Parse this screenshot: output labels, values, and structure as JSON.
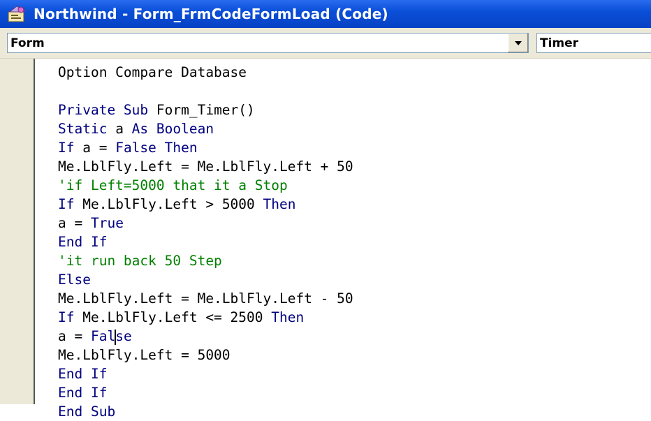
{
  "window": {
    "title": "Northwind - Form_FrmCodeFormLoad (Code)",
    "icon": "vba-code-window-icon"
  },
  "toolbar": {
    "object_combo": {
      "value": "Form"
    },
    "procedure_combo": {
      "value": "Timer"
    }
  },
  "colors": {
    "titlebar": "#0a4fd8",
    "keyword": "#00007f",
    "comment": "#007f00",
    "plain": "#000000",
    "gutter": "#ece9d8"
  },
  "code": {
    "line0": {
      "t0": "Option Compare Database"
    },
    "line2": {
      "k0": "Private Sub ",
      "t1": "Form_Timer()"
    },
    "line3": {
      "k0": "Static ",
      "t1": "a ",
      "k2": "As Boolean"
    },
    "line4": {
      "k0": "If ",
      "t1": "a = ",
      "k2": "False Then"
    },
    "line5": {
      "t0": "Me.LblFly.Left = Me.LblFly.Left + 50"
    },
    "line6": {
      "c0": "'if Left=5000 that it a Stop"
    },
    "line7": {
      "k0": "If ",
      "t1": "Me.LblFly.Left > 5000 ",
      "k2": "Then"
    },
    "line8": {
      "t0": "a = ",
      "k1": "True"
    },
    "line9": {
      "k0": "End If"
    },
    "line10": {
      "c0": "'it run back 50 Step"
    },
    "line11": {
      "k0": "Else"
    },
    "line12": {
      "t0": "Me.LblFly.Left = Me.LblFly.Left - 50"
    },
    "line13": {
      "k0": "If ",
      "t1": "Me.LblFly.Left <= 2500 ",
      "k2": "Then"
    },
    "line14": {
      "t0": "a = ",
      "k1": "Fal",
      "k2": "se"
    },
    "line15": {
      "t0": "Me.LblFly.Left = 5000"
    },
    "line16": {
      "k0": "End If"
    },
    "line17": {
      "k0": "End If"
    },
    "line18": {
      "k0": "End Sub"
    }
  }
}
